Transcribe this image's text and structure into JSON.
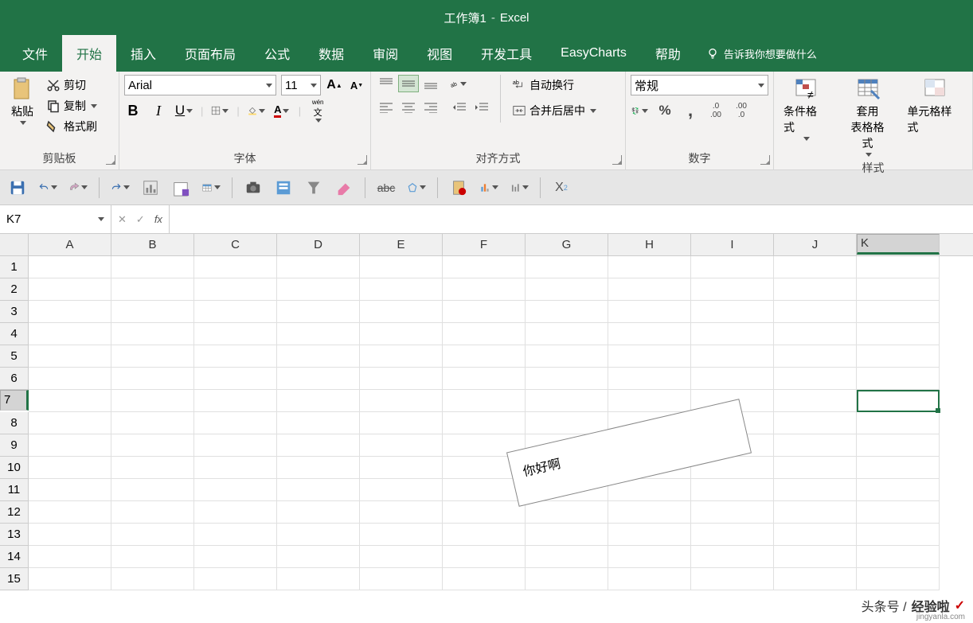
{
  "title": {
    "workbook": "工作簿1",
    "dash": "-",
    "app": "Excel"
  },
  "tabs": [
    "文件",
    "开始",
    "插入",
    "页面布局",
    "公式",
    "数据",
    "审阅",
    "视图",
    "开发工具",
    "EasyCharts",
    "帮助"
  ],
  "active_tab": "开始",
  "tellme": "告诉我你想要做什么",
  "clipboard": {
    "cut": "剪切",
    "copy": "复制",
    "format_painter": "格式刷",
    "paste": "粘贴",
    "group": "剪贴板"
  },
  "font": {
    "name": "Arial",
    "size": "11",
    "group": "字体",
    "wen": "文"
  },
  "alignment": {
    "wrap": "自动换行",
    "merge": "合并后居中",
    "group": "对齐方式"
  },
  "number": {
    "format": "常规",
    "group": "数字"
  },
  "styles": {
    "cond": "条件格式",
    "table": "套用\n表格格式",
    "cellstyle": "单元格样式",
    "group": "样式"
  },
  "formula": {
    "namebox": "K7",
    "fx": "fx"
  },
  "columns": [
    "A",
    "B",
    "C",
    "D",
    "E",
    "F",
    "G",
    "H",
    "I",
    "J",
    "K"
  ],
  "rows": [
    "1",
    "2",
    "3",
    "4",
    "5",
    "6",
    "7",
    "8",
    "9",
    "10",
    "11",
    "12",
    "13",
    "14",
    "15"
  ],
  "selected_col": "K",
  "selected_row": "7",
  "textbox": "你好啊",
  "watermark": {
    "prefix": "头条号 /",
    "main": "经验啦",
    "sub": "jingyanla.com"
  },
  "number_fmt_symbols": {
    "currency": "¥",
    "percent": "%",
    "comma": ",",
    "inc": ".0 .00",
    "dec": ".00 .0"
  }
}
